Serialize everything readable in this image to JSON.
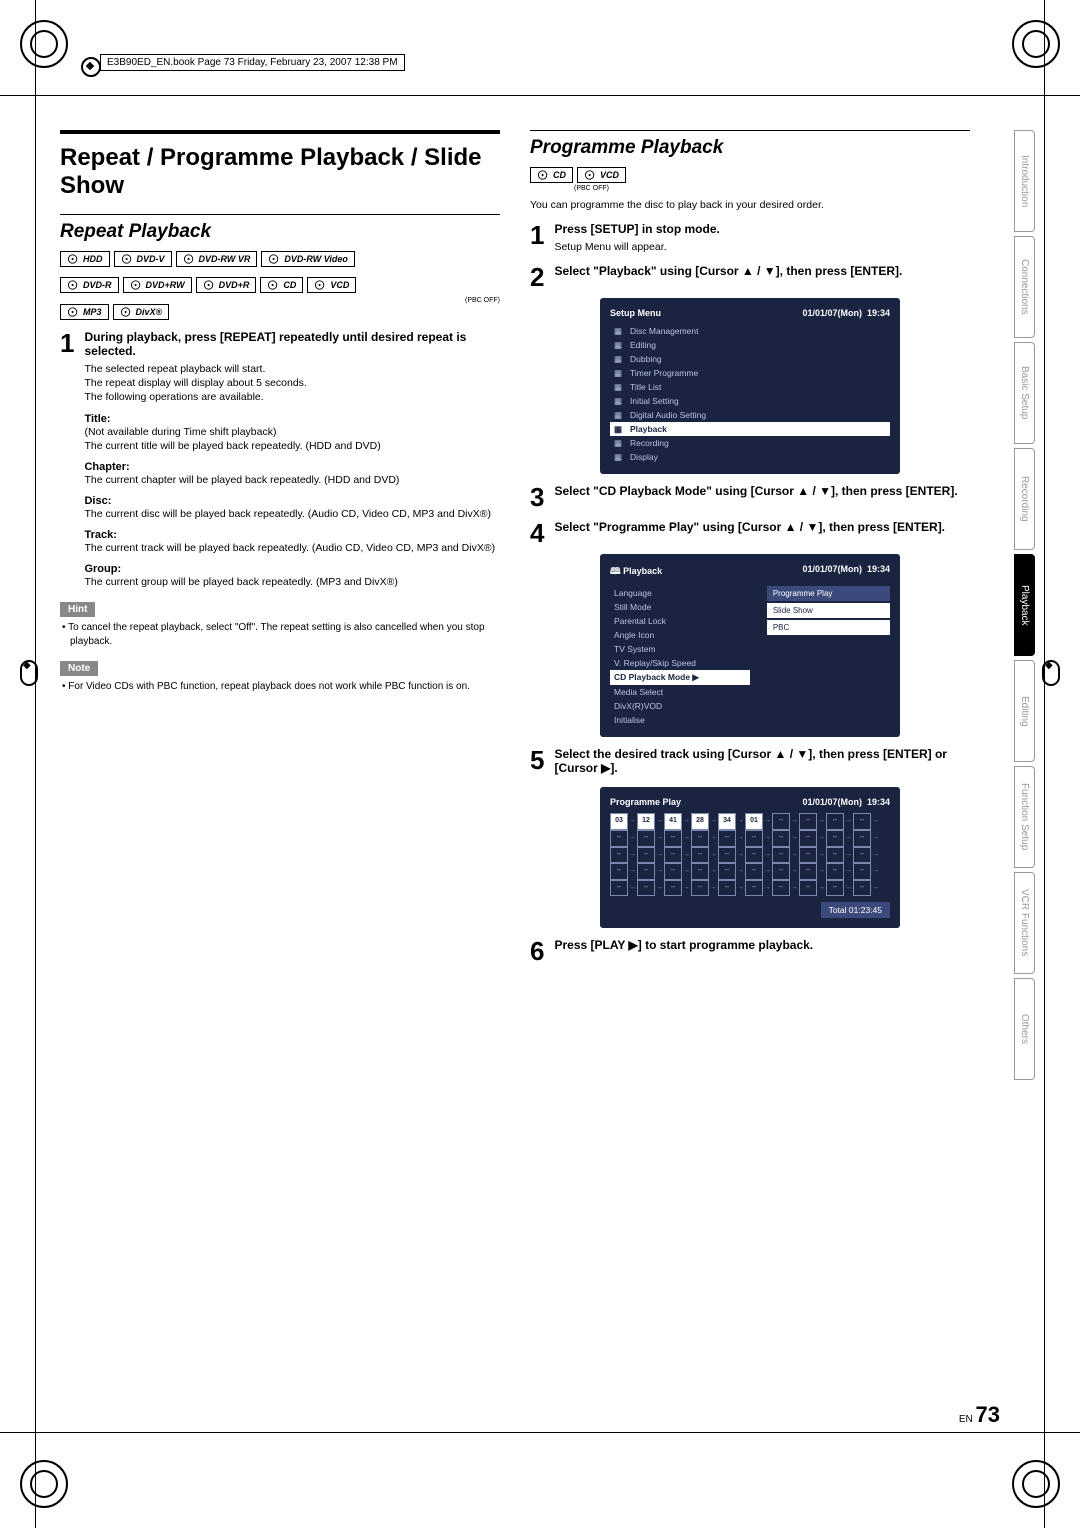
{
  "book_header": "E3B90ED_EN.book  Page 73  Friday, February 23, 2007  12:38 PM",
  "main_title_1": "Repeat / Programme Playback / Slide Show",
  "sub_repeat": "Repeat Playback",
  "disc_row1": [
    "HDD",
    "DVD-V",
    "DVD-RW VR",
    "DVD-RW Video"
  ],
  "disc_row2": [
    "DVD-R",
    "DVD+RW",
    "DVD+R",
    "CD",
    "VCD"
  ],
  "disc_row3": [
    "MP3",
    "DivX®"
  ],
  "pbc_off": "(PBC OFF)",
  "step1": {
    "num": "1",
    "title": "During playback, press [REPEAT] repeatedly until desired repeat is selected.",
    "body": "The selected repeat playback will start.\nThe repeat display will display about 5 seconds.\nThe following operations are available."
  },
  "paras": [
    {
      "t": "Title:",
      "b": "(Not available during Time shift playback)\nThe current title will be played back repeatedly. (HDD and DVD)"
    },
    {
      "t": "Chapter:",
      "b": "The current chapter will be played back repeatedly. (HDD and DVD)"
    },
    {
      "t": "Disc:",
      "b": "The current disc will be played back repeatedly. (Audio CD, Video CD, MP3 and DivX®)"
    },
    {
      "t": "Track:",
      "b": "The current track will be played back repeatedly. (Audio CD, Video CD, MP3 and DivX®)"
    },
    {
      "t": "Group:",
      "b": "The current group will be played back repeatedly. (MP3 and DivX®)"
    }
  ],
  "hint_label": "Hint",
  "hint_text": "• To cancel the repeat playback, select \"Off\". The repeat setting is also cancelled when you stop playback.",
  "note_label": "Note",
  "note_text": "• For Video CDs with PBC function, repeat playback does not work while PBC function is on.",
  "prog_title": "Programme Playback",
  "prog_icons": [
    "CD",
    "VCD"
  ],
  "prog_pbc": "(PBC OFF)",
  "prog_intro": "You can programme the disc to play back in your desired order.",
  "psteps": [
    {
      "n": "1",
      "t": "Press [SETUP] in stop mode.",
      "b": "Setup Menu will appear."
    },
    {
      "n": "2",
      "t": "Select \"Playback\" using [Cursor ▲ / ▼], then press [ENTER].",
      "b": ""
    },
    {
      "n": "3",
      "t": "Select \"CD Playback Mode\" using [Cursor ▲ / ▼], then press [ENTER].",
      "b": ""
    },
    {
      "n": "4",
      "t": "Select \"Programme Play\" using [Cursor ▲ / ▼], then press [ENTER].",
      "b": ""
    },
    {
      "n": "5",
      "t": "Select the desired track using [Cursor ▲ / ▼], then press [ENTER] or [Cursor ▶].",
      "b": ""
    },
    {
      "n": "6",
      "t": "Press [PLAY ▶] to start programme playback.",
      "b": ""
    }
  ],
  "screen1": {
    "title": "Setup Menu",
    "date": "01/01/07(Mon)",
    "time": "19:34",
    "items": [
      "Disc Management",
      "Editing",
      "Dubbing",
      "Timer Programme",
      "Title List",
      "Initial Setting",
      "Digital Audio Setting",
      "Playback",
      "Recording",
      "Display"
    ],
    "hl": 7
  },
  "screen2": {
    "title": "Playback",
    "date": "01/01/07(Mon)",
    "time": "19:34",
    "left": [
      "Language",
      "Still Mode",
      "Parental Lock",
      "Angle Icon",
      "TV System",
      "V. Replay/Skip Speed",
      "CD Playback Mode",
      "Media Select",
      "DivX(R)VOD",
      "Initialise"
    ],
    "left_hl": 6,
    "right": [
      "Programme Play",
      "Slide Show",
      "PBC"
    ],
    "right_hl": 0
  },
  "screen3": {
    "title": "Programme Play",
    "date": "01/01/07(Mon)",
    "time": "19:34",
    "cells": [
      [
        "03",
        "12",
        "41",
        "28",
        "34",
        "01",
        "--",
        "--",
        "--",
        "--"
      ],
      [
        "--",
        "--",
        "--",
        "--",
        "--",
        "--",
        "--",
        "--",
        "--",
        "--"
      ],
      [
        "--",
        "--",
        "--",
        "--",
        "--",
        "--",
        "--",
        "--",
        "--",
        "--"
      ],
      [
        "--",
        "--",
        "--",
        "--",
        "--",
        "--",
        "--",
        "--",
        "--",
        "--"
      ],
      [
        "--",
        "--",
        "--",
        "--",
        "--",
        "--",
        "--",
        "--",
        "--",
        "--"
      ]
    ],
    "total_label": "Total",
    "total_val": "01:23:45"
  },
  "tabs": [
    "Introduction",
    "Connections",
    "Basic Setup",
    "Recording",
    "Playback",
    "Editing",
    "Function Setup",
    "VCR Functions",
    "Others"
  ],
  "tab_active": 4,
  "page_en": "EN",
  "page_num": "73"
}
